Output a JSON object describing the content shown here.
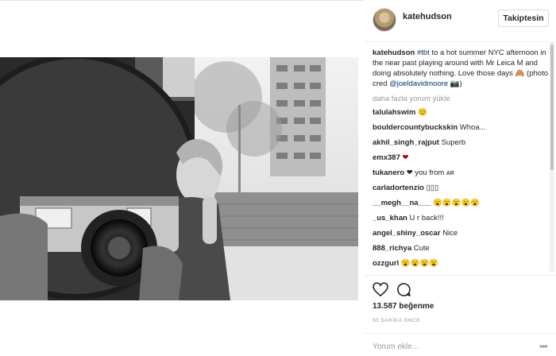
{
  "post": {
    "username": "katehudson",
    "follow_label": "Takiptesin",
    "caption": {
      "author": "katehudson",
      "hashtag": "#tbt",
      "text": " to a hot summer NYC afternoon in the near past playing around with Mr Leica M and doing absolutely nothing. Love those days ",
      "emoji": "🙈",
      "credit_prefix": " (photo cred ",
      "mention": "@joeldavidmoore",
      "credit_suffix": " 📷)"
    },
    "load_more": "daha fazla yorum yükle",
    "comments": [
      {
        "user": "talulahswim",
        "text": "😊"
      },
      {
        "user": "bouldercountybuckskin",
        "text": "Whoa..."
      },
      {
        "user": "akhil_singh_rajput",
        "text": "Superb"
      },
      {
        "user": "emx387",
        "text": "❤"
      },
      {
        "user": "tukanero",
        "text": "❤ you from ᴀʀ"
      },
      {
        "user": "carladortenzio",
        "text": "▯▯▯"
      },
      {
        "user": "__megh__na___",
        "text": "😮😮😮😮😮"
      },
      {
        "user": "_us_khan",
        "text": "U r back!!!"
      },
      {
        "user": "angel_shiny_oscar",
        "text": "Nice"
      },
      {
        "user": "888_richya",
        "text": "Cute"
      },
      {
        "user": "ozzgurl",
        "text": "😮😮😮😮"
      }
    ],
    "likes": "13.587 beğenme",
    "time": "30 DAKİKA ÖNCE",
    "comment_placeholder": "Yorum ekle...",
    "more": "•••"
  },
  "icons": {
    "heart": "heart-icon",
    "comment": "comment-icon",
    "more": "more-options-icon"
  },
  "colors": {
    "link": "#003569",
    "muted": "#999999",
    "border": "#efefef"
  }
}
